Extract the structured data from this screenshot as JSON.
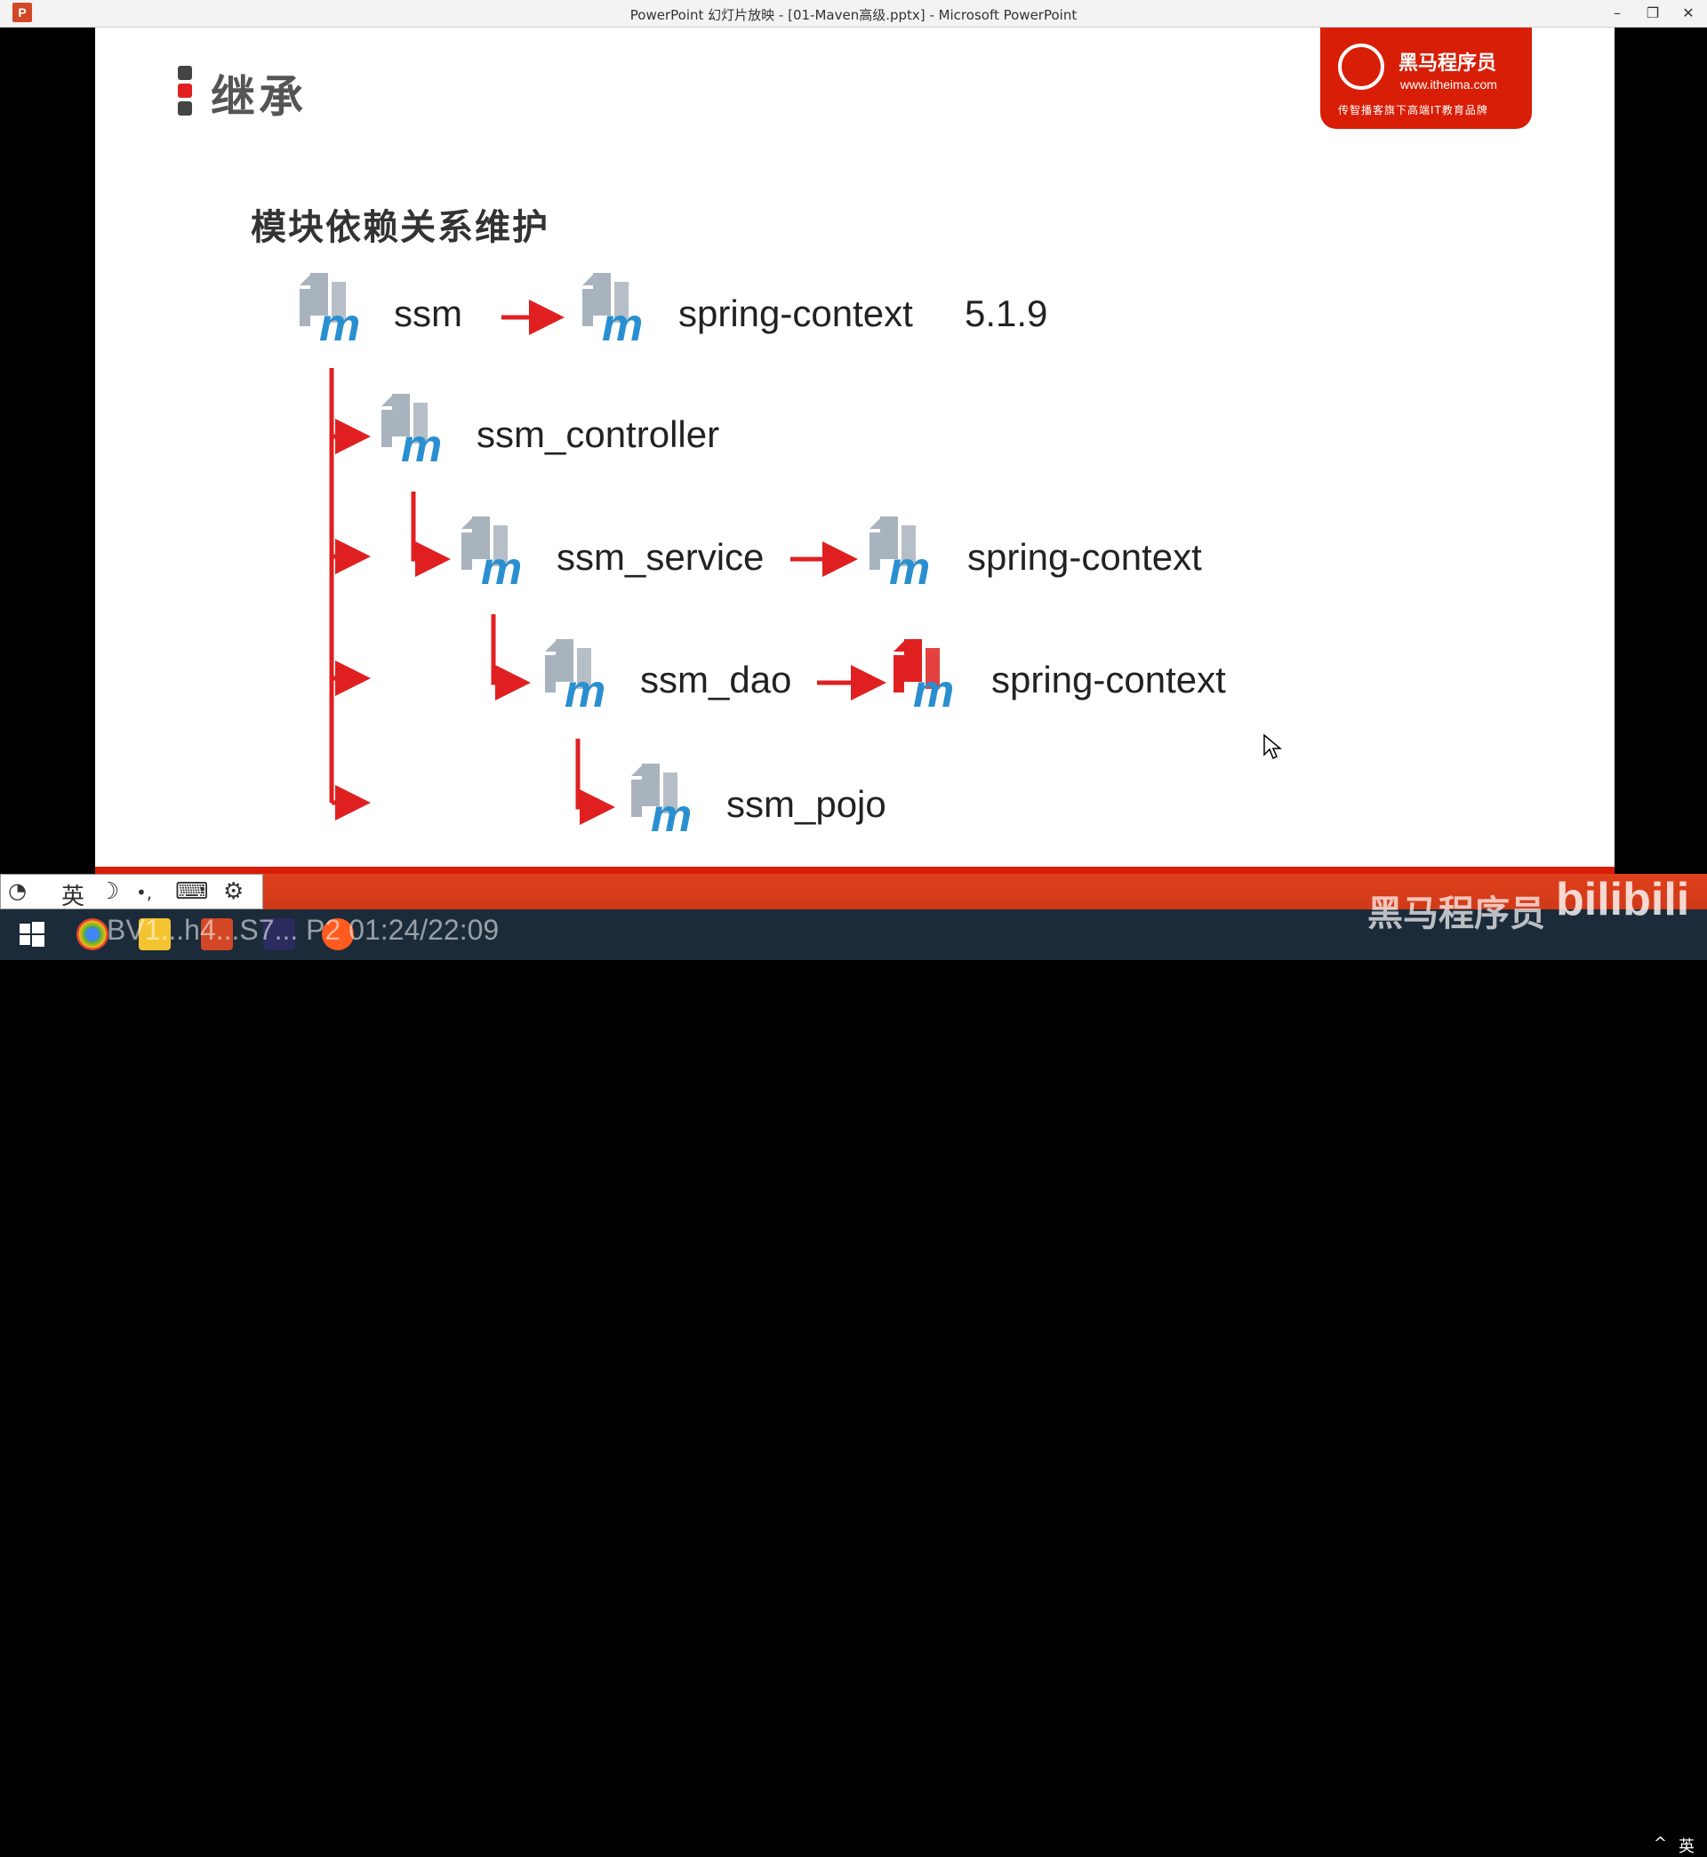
{
  "window": {
    "title": "PowerPoint 幻灯片放映 - [01-Maven高级.pptx] - Microsoft PowerPoint",
    "app_icon_letter": "P",
    "minimize": "–",
    "restore": "❐",
    "close": "✕"
  },
  "slide": {
    "title": "继承",
    "subtitle": "模块依赖关系维护",
    "logo": {
      "name": "黑马程序员",
      "url": "www.itheima.com",
      "tagline": "传智播客旗下高端IT教育品牌"
    },
    "nodes": {
      "ssm": "ssm",
      "spring_context_top": "spring-context",
      "version": "5.1.9",
      "controller": "ssm_controller",
      "service": "ssm_service",
      "spring_context_service": "spring-context",
      "dao": "ssm_dao",
      "spring_context_dao": "spring-context",
      "pojo": "ssm_pojo"
    },
    "icon_letter": "m",
    "colors": {
      "accent_red": "#e02020",
      "icon_gray": "#a9b3bd",
      "icon_blue": "#2a8fd0",
      "logo_red": "#d81e06"
    }
  },
  "ime_bar": {
    "lang": "英",
    "moon": "☽",
    "punct": "•,",
    "keyboard": "⌨",
    "settings": "⚙"
  },
  "overlay": {
    "video_info": "BV1...h4...S7... P2 01:24/22:09",
    "watermark": "黑马程序员",
    "platform": "bilibili"
  },
  "tray": {
    "chevron": "^",
    "lang": "英"
  }
}
